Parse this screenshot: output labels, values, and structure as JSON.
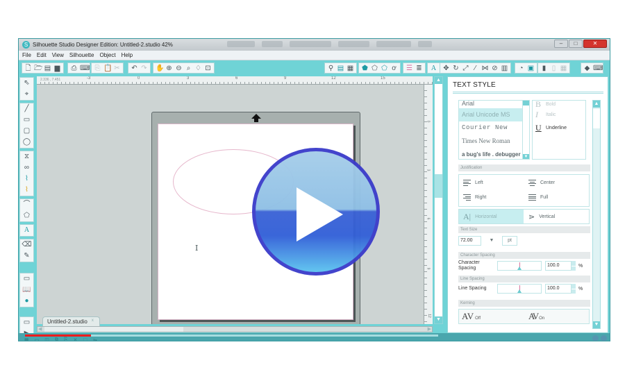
{
  "window": {
    "title": "Silhouette Studio Designer Edition: Untitled-2.studio 42%",
    "app_icon": "silhouette-logo-icon",
    "controls": [
      "minimize",
      "maximize",
      "close"
    ]
  },
  "menu": [
    "File",
    "Edit",
    "View",
    "Silhouette",
    "Object",
    "Help"
  ],
  "toolbar": {
    "left_icons": [
      "new-document-icon",
      "open-folder-icon",
      "save-icon",
      "save-library-icon",
      "print-icon",
      "send-to-silhouette-icon",
      "copy-icon",
      "paste-icon",
      "cut-icon",
      "undo-icon",
      "redo-icon",
      "pan-hand-icon",
      "zoom-in-icon",
      "zoom-out-icon",
      "zoom-select-icon",
      "drag-zoom-icon",
      "fit-to-page-icon"
    ],
    "right_icons": [
      "design-page-settings-icon",
      "fill-color-icon",
      "fill-pattern-icon",
      "line-color-icon",
      "line-style-icon",
      "line-style-icon-2",
      "shadow-icon",
      "line-settings-icon",
      "line-type-icon",
      "text-style-icon",
      "transform-icon",
      "rotate-icon",
      "scale-icon",
      "shear-icon",
      "align-icon",
      "replicate-icon",
      "modify-icon",
      "offset-icon",
      "trace-icon",
      "cut-settings-icon",
      "library-icon",
      "store-icon",
      "grid-icon",
      "eraser-icon",
      "send-icon"
    ]
  },
  "left_tools": [
    "select-arrow-icon",
    "edit-points-icon",
    "line-tool-icon",
    "rectangle-tool-icon",
    "rounded-rectangle-tool-icon",
    "ellipse-tool-icon",
    "polygon-tool-icon",
    "curve-tool-icon",
    "freehand-tool-icon",
    "smooth-freehand-tool-icon",
    "arc-tool-icon",
    "regular-polygon-tool-icon",
    "text-tool-icon",
    "eraser-tool-icon",
    "knife-tool-icon",
    "show-cut-settings-icon",
    "library-view-icon",
    "store-icon",
    "page-view-icon",
    "expand-icon"
  ],
  "ruler": {
    "coordinates": "2.336 , 7.451",
    "h_labels": [
      "-3",
      "0",
      "3",
      "6",
      "9",
      "12",
      "15"
    ],
    "v_labels": [
      "0",
      "3",
      "6",
      "9",
      "12"
    ]
  },
  "document_tab": {
    "label": "Untitled-2.studio",
    "close": "x"
  },
  "video": {
    "progress_fraction": 0.16,
    "play_button": "play-icon"
  },
  "panel": {
    "title": "TEXT STYLE",
    "fonts": [
      "Arial",
      "Arial Unicode MS",
      "Courier New",
      "Times New Roman",
      "a bug's life . debugger"
    ],
    "selected_font": "Arial Unicode MS",
    "styles": [
      {
        "glyph": "B",
        "label": "Bold",
        "active": false
      },
      {
        "glyph": "I",
        "label": "Italic",
        "active": false
      },
      {
        "glyph": "U",
        "label": "Underline",
        "active": true
      }
    ],
    "justification": {
      "header": "Justification",
      "left": "Left",
      "center": "Center",
      "right": "Right",
      "full": "Full"
    },
    "orientation": {
      "horizontal": "Horizontal",
      "vertical": "Vertical",
      "selected": "Horizontal"
    },
    "text_size": {
      "header": "Text Size",
      "value": "72.00",
      "dropdown": "▼",
      "unit": "pt"
    },
    "character_spacing": {
      "header": "Character Spacing",
      "label": "Character Spacing",
      "value": "100.0",
      "unit": "%"
    },
    "line_spacing": {
      "header": "Line Spacing",
      "label": "Line Spacing",
      "value": "100.0",
      "unit": "%"
    },
    "kerning": {
      "header": "Kerning",
      "off_glyph": "AV",
      "off_label": "Off",
      "on_glyph": "AV",
      "on_label": "On"
    }
  }
}
